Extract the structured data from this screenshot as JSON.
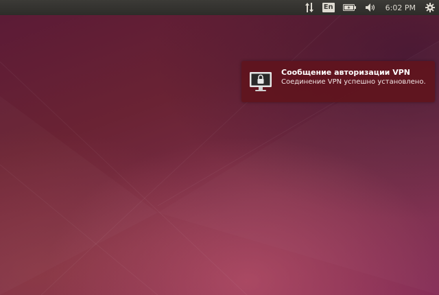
{
  "panel": {
    "indicators": [
      {
        "icon": "network-updown-icon"
      },
      {
        "icon": "keyboard-language-icon",
        "label": "En"
      },
      {
        "icon": "battery-icon"
      },
      {
        "icon": "volume-icon"
      }
    ],
    "clock": "6:02 PM",
    "session_icon": "gear-icon",
    "colors": {
      "panel": "#3c3b37",
      "text": "#dfdbd2"
    }
  },
  "notification": {
    "icon": "vpn-lock-monitor-icon",
    "title": "Сообщение авторизации VPN",
    "body": "Соединение VPN успешно установлено.",
    "colors": {
      "background": "#60141e",
      "title": "#ffffff"
    }
  },
  "desktop": {
    "colors": {
      "base": "#6a2334",
      "accent": "#842c56"
    }
  }
}
